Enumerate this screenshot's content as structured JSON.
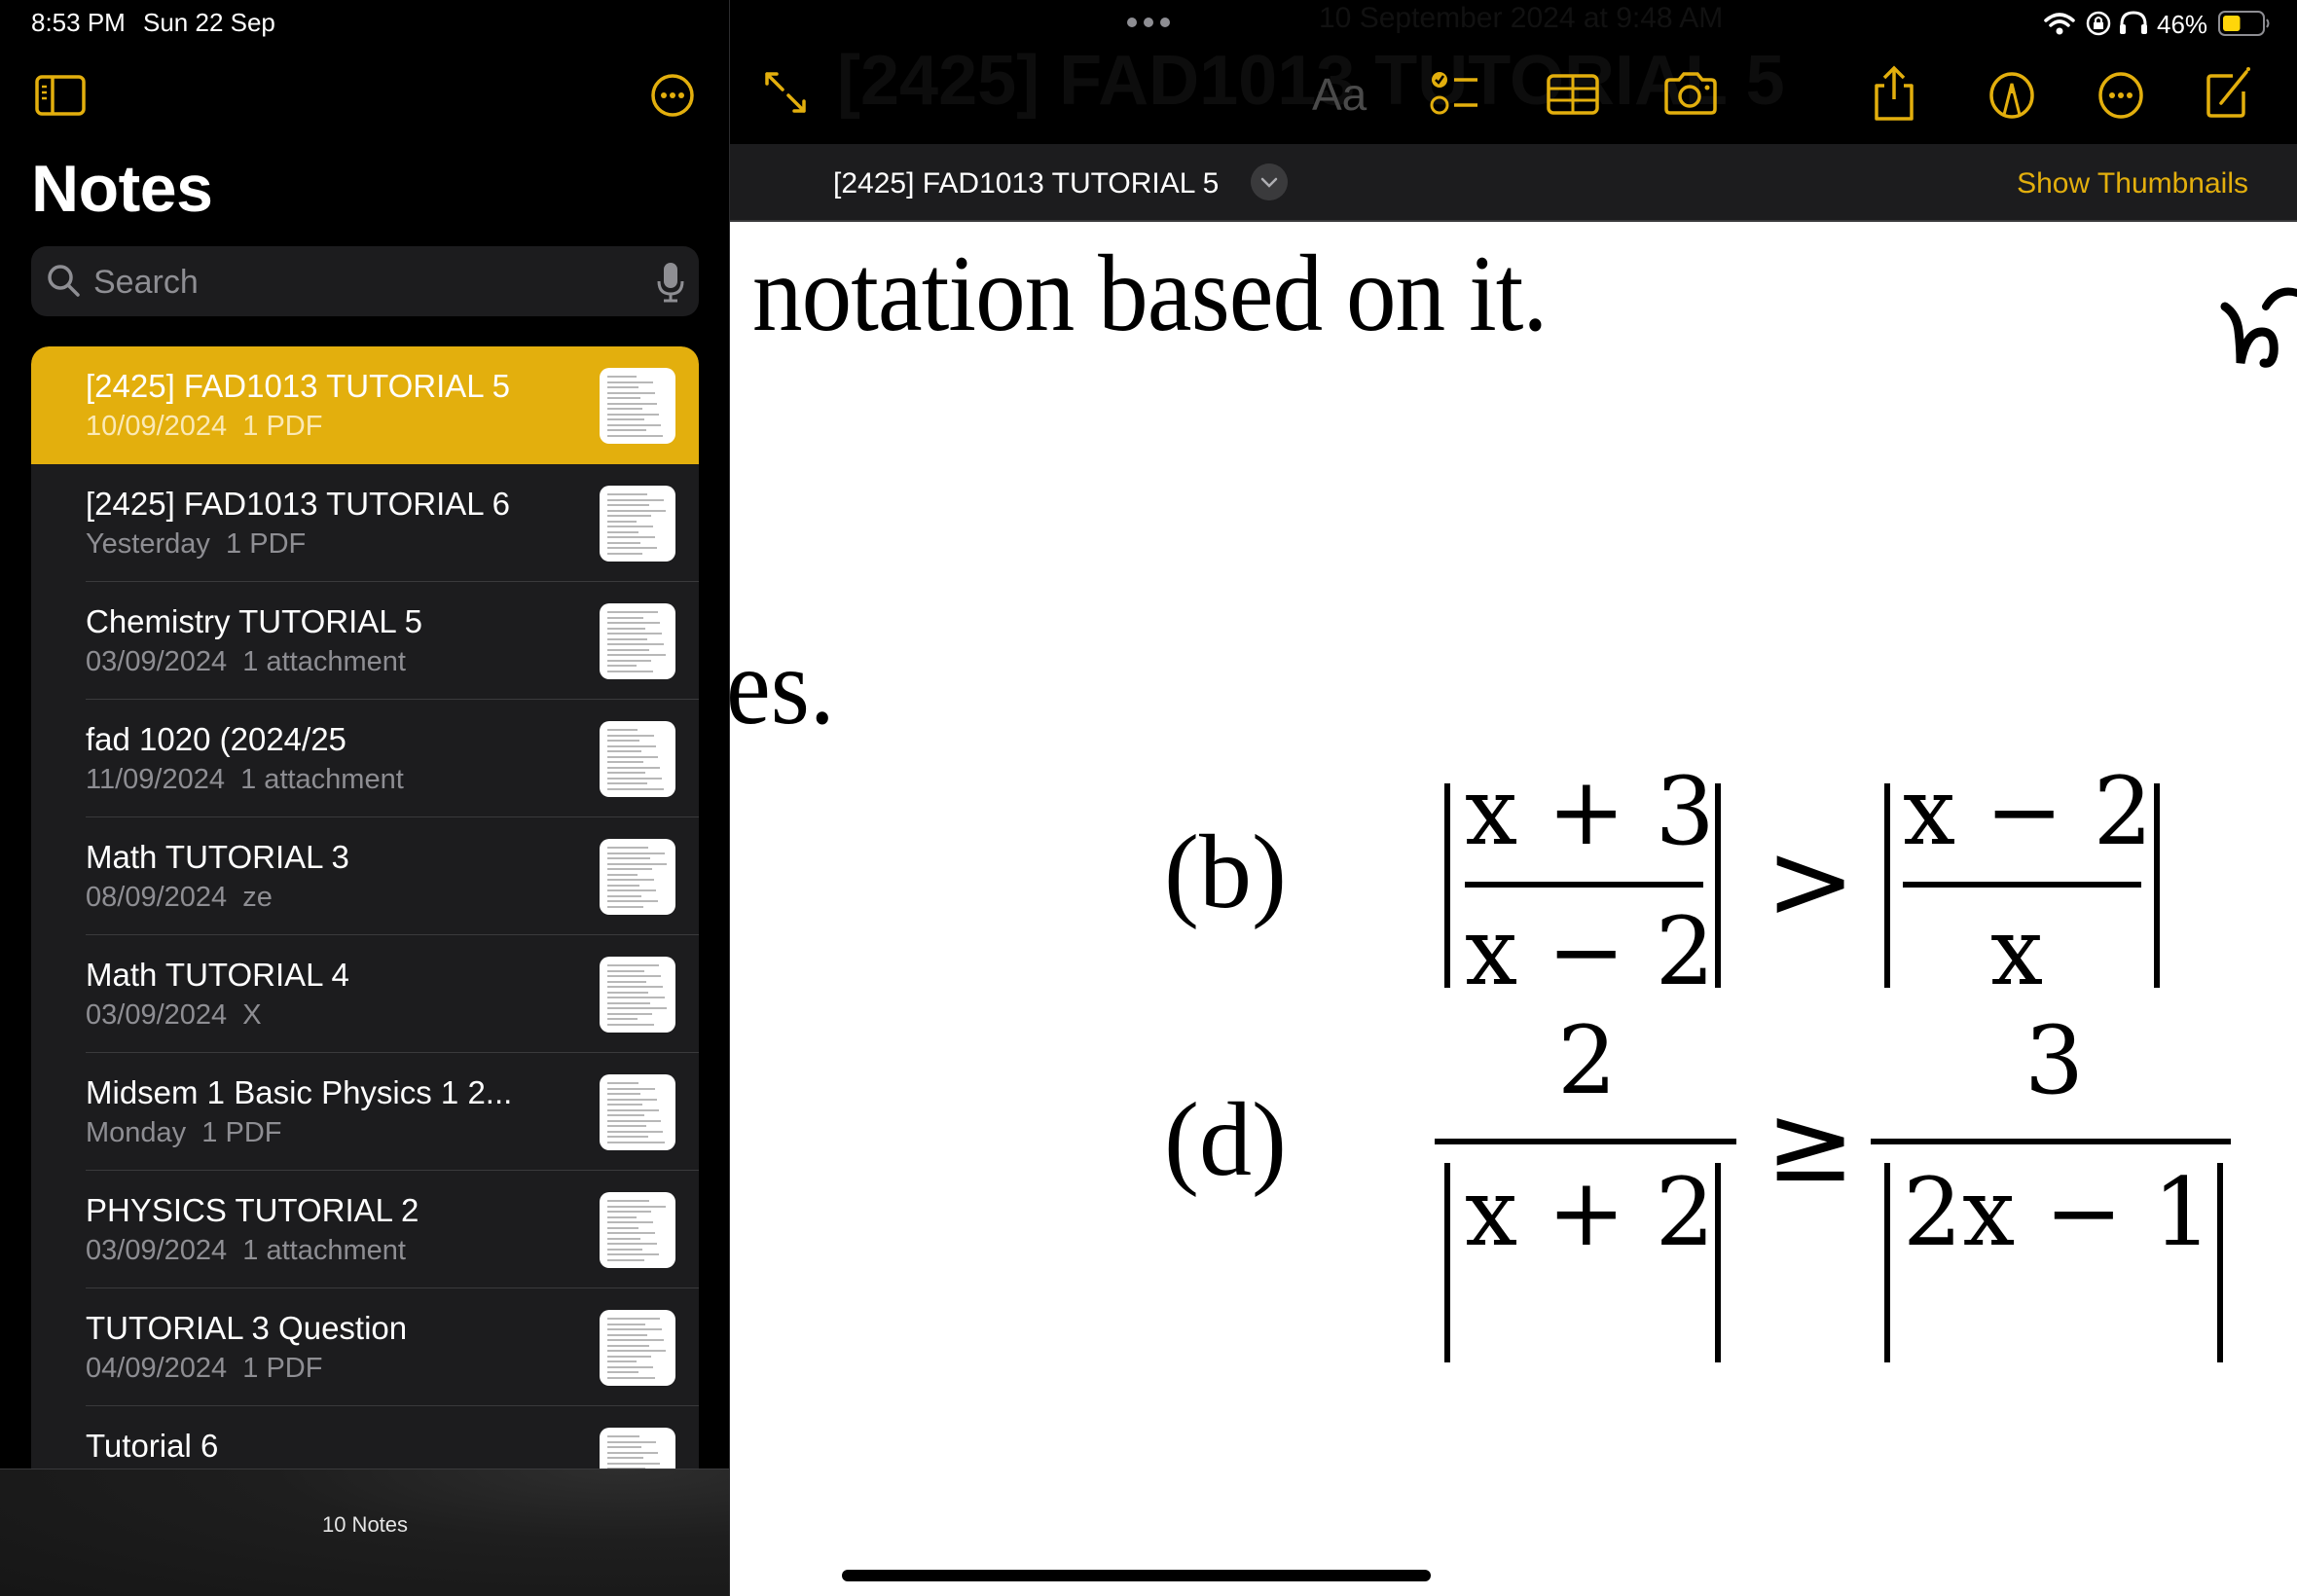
{
  "status_bar": {
    "time": "8:53 PM",
    "date": "Sun 22 Sep",
    "battery_percent": "46%",
    "battery_level": 0.46,
    "icons": [
      "wifi-icon",
      "orientation-lock-icon",
      "headphones-icon",
      "battery-icon"
    ]
  },
  "sidebar": {
    "title": "Notes",
    "search": {
      "placeholder": "Search",
      "value": ""
    },
    "notes": [
      {
        "title": "[2425] FAD1013 TUTORIAL 5",
        "date": "10/09/2024",
        "detail": "1 PDF",
        "selected": true
      },
      {
        "title": "[2425] FAD1013 TUTORIAL 6",
        "date": "Yesterday",
        "detail": "1 PDF",
        "selected": false
      },
      {
        "title": "Chemistry TUTORIAL 5",
        "date": "03/09/2024",
        "detail": "1 attachment",
        "selected": false
      },
      {
        "title": "fad 1020 (2024/25",
        "date": "11/09/2024",
        "detail": "1 attachment",
        "selected": false
      },
      {
        "title": "Math TUTORIAL 3",
        "date": "08/09/2024",
        "detail": "ze",
        "selected": false
      },
      {
        "title": "Math TUTORIAL 4",
        "date": "03/09/2024",
        "detail": "X",
        "selected": false
      },
      {
        "title": "Midsem 1 Basic Physics 1 2...",
        "date": "Monday",
        "detail": "1 PDF",
        "selected": false
      },
      {
        "title": "PHYSICS TUTORIAL 2",
        "date": "03/09/2024",
        "detail": "1 attachment",
        "selected": false
      },
      {
        "title": "TUTORIAL 3 Question",
        "date": "04/09/2024",
        "detail": "1 PDF",
        "selected": false
      },
      {
        "title": "Tutorial 6",
        "date": "",
        "detail": "",
        "selected": false
      }
    ],
    "footer_count": "10 Notes"
  },
  "toolbar": {
    "ghost_date": "10 September 2024 at 9:48 AM",
    "ghost_title": "[2425] FAD1013 TUTORIAL 5",
    "format_label": "Aa",
    "icons": [
      "expand-icon",
      "format-text-icon",
      "checklist-icon",
      "table-icon",
      "camera-icon",
      "share-icon",
      "markup-icon",
      "more-icon",
      "compose-icon"
    ]
  },
  "pdf_header": {
    "title": "[2425] FAD1013 TUTORIAL 5",
    "show_thumbnails": "Show Thumbnails"
  },
  "document": {
    "line1": "notation based on it.",
    "line2": "es.",
    "problem_b": {
      "label": "(b)",
      "lhs_num": "x + 3",
      "lhs_den": "x − 2",
      "relation": ">",
      "rhs_num": "x − 2",
      "rhs_den": "x"
    },
    "problem_d": {
      "label": "(d)",
      "lhs_num": "2",
      "lhs_den": "x + 2",
      "relation": "≥",
      "rhs_num": "3",
      "rhs_den": "2x − 1"
    }
  },
  "colors": {
    "accent": "#e3af0d",
    "list_bg": "#1c1c1e",
    "secondary_text": "#8e8e93",
    "separator": "#3a3a3c",
    "battery_fill": "#ffd60a"
  }
}
